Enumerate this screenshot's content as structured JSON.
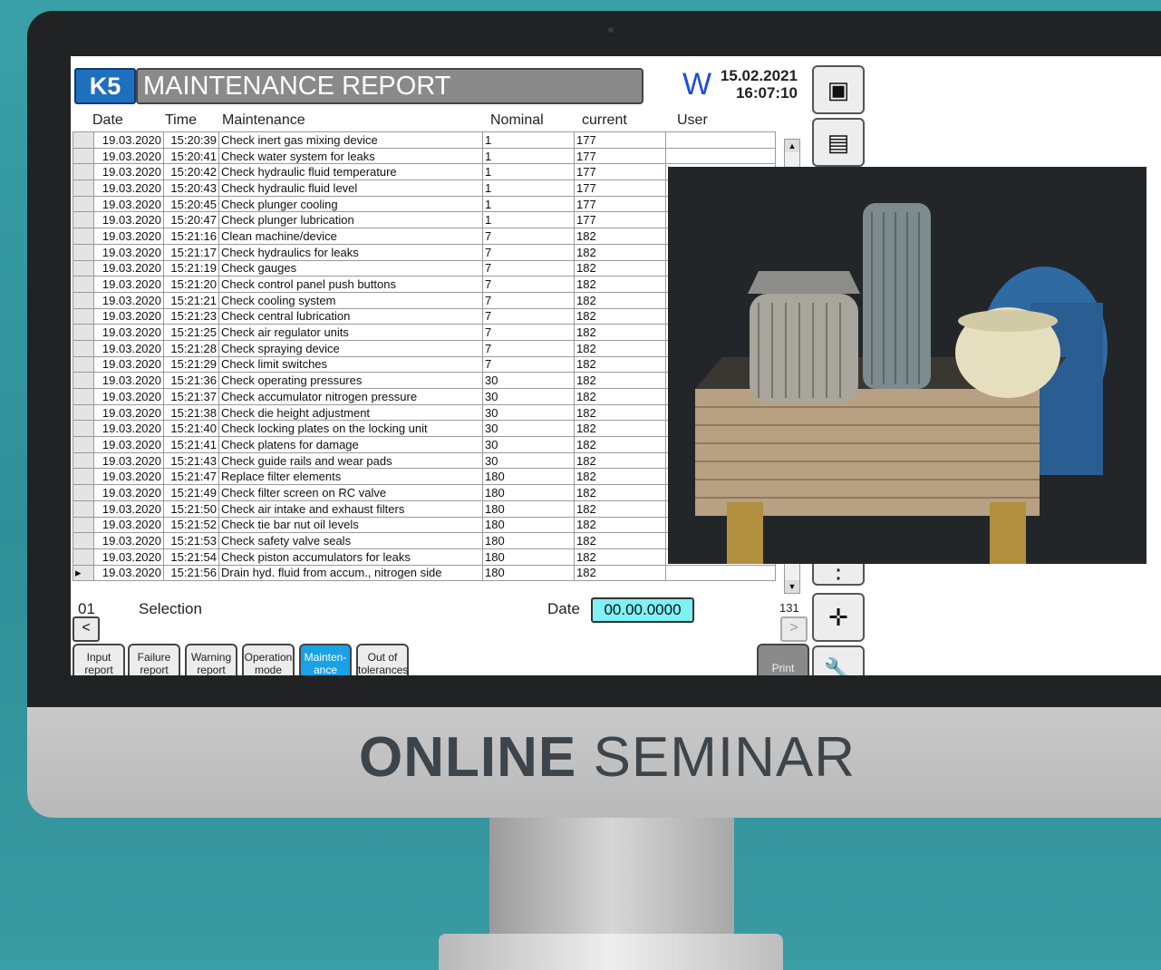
{
  "report": {
    "machine_id": "K5",
    "title": "MAINTENANCE REPORT",
    "brand_mark": "W",
    "date": "15.02.2021",
    "time": "16:07:10"
  },
  "columns": {
    "date": "Date",
    "time": "Time",
    "maintenance": "Maintenance",
    "nominal": "Nominal",
    "current": "current",
    "user": "User"
  },
  "rows": [
    {
      "date": "19.03.2020",
      "time": "15:20:39",
      "task": "Check inert gas mixing device",
      "nominal": "1",
      "current": "177"
    },
    {
      "date": "19.03.2020",
      "time": "15:20:41",
      "task": "Check water system for leaks",
      "nominal": "1",
      "current": "177"
    },
    {
      "date": "19.03.2020",
      "time": "15:20:42",
      "task": "Check hydraulic fluid temperature",
      "nominal": "1",
      "current": "177"
    },
    {
      "date": "19.03.2020",
      "time": "15:20:43",
      "task": "Check hydraulic fluid level",
      "nominal": "1",
      "current": "177"
    },
    {
      "date": "19.03.2020",
      "time": "15:20:45",
      "task": "Check plunger cooling",
      "nominal": "1",
      "current": "177"
    },
    {
      "date": "19.03.2020",
      "time": "15:20:47",
      "task": "Check plunger lubrication",
      "nominal": "1",
      "current": "177"
    },
    {
      "date": "19.03.2020",
      "time": "15:21:16",
      "task": "Clean machine/device",
      "nominal": "7",
      "current": "182"
    },
    {
      "date": "19.03.2020",
      "time": "15:21:17",
      "task": "Check hydraulics for leaks",
      "nominal": "7",
      "current": "182"
    },
    {
      "date": "19.03.2020",
      "time": "15:21:19",
      "task": "Check gauges",
      "nominal": "7",
      "current": "182"
    },
    {
      "date": "19.03.2020",
      "time": "15:21:20",
      "task": "Check control panel push buttons",
      "nominal": "7",
      "current": "182"
    },
    {
      "date": "19.03.2020",
      "time": "15:21:21",
      "task": "Check cooling system",
      "nominal": "7",
      "current": "182"
    },
    {
      "date": "19.03.2020",
      "time": "15:21:23",
      "task": "Check central lubrication",
      "nominal": "7",
      "current": "182"
    },
    {
      "date": "19.03.2020",
      "time": "15:21:25",
      "task": "Check air regulator units",
      "nominal": "7",
      "current": "182"
    },
    {
      "date": "19.03.2020",
      "time": "15:21:28",
      "task": "Check spraying device",
      "nominal": "7",
      "current": "182"
    },
    {
      "date": "19.03.2020",
      "time": "15:21:29",
      "task": "Check limit switches",
      "nominal": "7",
      "current": "182"
    },
    {
      "date": "19.03.2020",
      "time": "15:21:36",
      "task": "Check operating pressures",
      "nominal": "30",
      "current": "182"
    },
    {
      "date": "19.03.2020",
      "time": "15:21:37",
      "task": "Check accumulator nitrogen pressure",
      "nominal": "30",
      "current": "182"
    },
    {
      "date": "19.03.2020",
      "time": "15:21:38",
      "task": "Check die height adjustment",
      "nominal": "30",
      "current": "182"
    },
    {
      "date": "19.03.2020",
      "time": "15:21:40",
      "task": "Check locking plates on the locking unit",
      "nominal": "30",
      "current": "182"
    },
    {
      "date": "19.03.2020",
      "time": "15:21:41",
      "task": "Check platens for damage",
      "nominal": "30",
      "current": "182"
    },
    {
      "date": "19.03.2020",
      "time": "15:21:43",
      "task": "Check guide rails and wear pads",
      "nominal": "30",
      "current": "182"
    },
    {
      "date": "19.03.2020",
      "time": "15:21:47",
      "task": "Replace filter elements",
      "nominal": "180",
      "current": "182"
    },
    {
      "date": "19.03.2020",
      "time": "15:21:49",
      "task": "Check filter screen on RC valve",
      "nominal": "180",
      "current": "182"
    },
    {
      "date": "19.03.2020",
      "time": "15:21:50",
      "task": "Check air intake and exhaust filters",
      "nominal": "180",
      "current": "182"
    },
    {
      "date": "19.03.2020",
      "time": "15:21:52",
      "task": "Check tie bar nut oil levels",
      "nominal": "180",
      "current": "182"
    },
    {
      "date": "19.03.2020",
      "time": "15:21:53",
      "task": "Check safety valve seals",
      "nominal": "180",
      "current": "182"
    },
    {
      "date": "19.03.2020",
      "time": "15:21:54",
      "task": "Check piston accumulators for leaks",
      "nominal": "180",
      "current": "182"
    },
    {
      "date": "19.03.2020",
      "time": "15:21:56",
      "task": "Drain hyd. fluid from accum., nitrogen side",
      "nominal": "180",
      "current": "182",
      "marker": "▸"
    }
  ],
  "footer": {
    "page": "01",
    "selection_label": "Selection",
    "date_label": "Date",
    "date_value": "00.00.0000",
    "count": "131",
    "prev": "<",
    "next": ">"
  },
  "tabs": [
    {
      "label": "Input report"
    },
    {
      "label": "Failure report"
    },
    {
      "label": "Warning report"
    },
    {
      "label": "Operation mode"
    },
    {
      "label": "Mainten- ance"
    },
    {
      "label": "Out of tolerances"
    }
  ],
  "print_label": "Print",
  "banner": {
    "bold": "ONLINE",
    "light": "SEMINAR"
  },
  "colors": {
    "accent": "#1aa2e6",
    "date_field": "#7ff0f3",
    "k5": "#1f6fbf",
    "background": "#3aa0a8"
  }
}
